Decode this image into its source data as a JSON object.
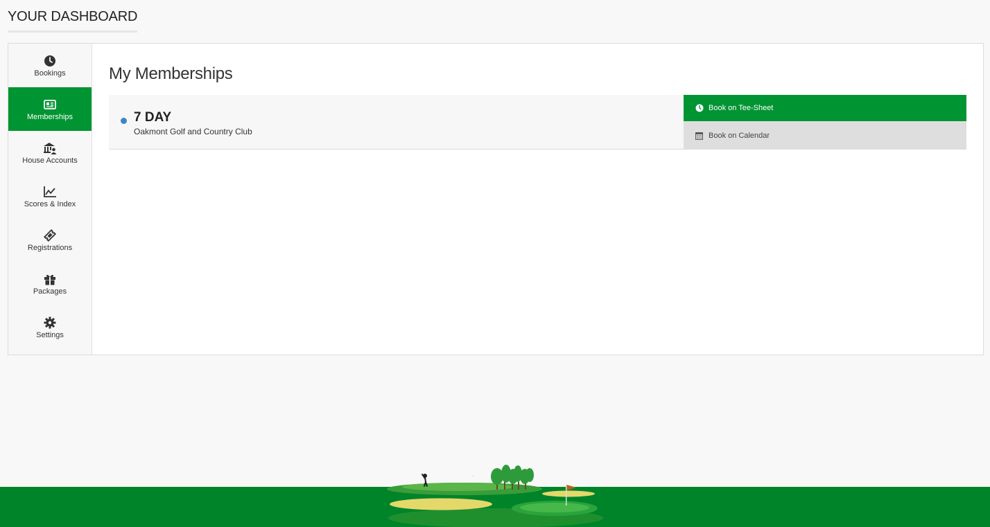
{
  "header": {
    "title": "YOUR DASHBOARD"
  },
  "sidebar": {
    "items": [
      {
        "label": "Bookings",
        "icon": "clock-icon",
        "active": false
      },
      {
        "label": "Memberships",
        "icon": "id-card-icon",
        "active": true
      },
      {
        "label": "House Accounts",
        "icon": "bank-user-icon",
        "active": false
      },
      {
        "label": "Scores & Index",
        "icon": "line-chart-icon",
        "active": false
      },
      {
        "label": "Registrations",
        "icon": "ticket-icon",
        "active": false
      },
      {
        "label": "Packages",
        "icon": "gift-icon",
        "active": false
      },
      {
        "label": "Settings",
        "icon": "gear-icon",
        "active": false
      }
    ]
  },
  "main": {
    "title": "My Memberships",
    "membership": {
      "name": "7 DAY",
      "club": "Oakmont Golf and Country Club",
      "status_color": "#3d86c6"
    },
    "actions": {
      "tee_sheet": "Book on Tee-Sheet",
      "calendar": "Book on Calendar"
    }
  },
  "colors": {
    "accent": "#009432",
    "footer": "#00842a"
  }
}
